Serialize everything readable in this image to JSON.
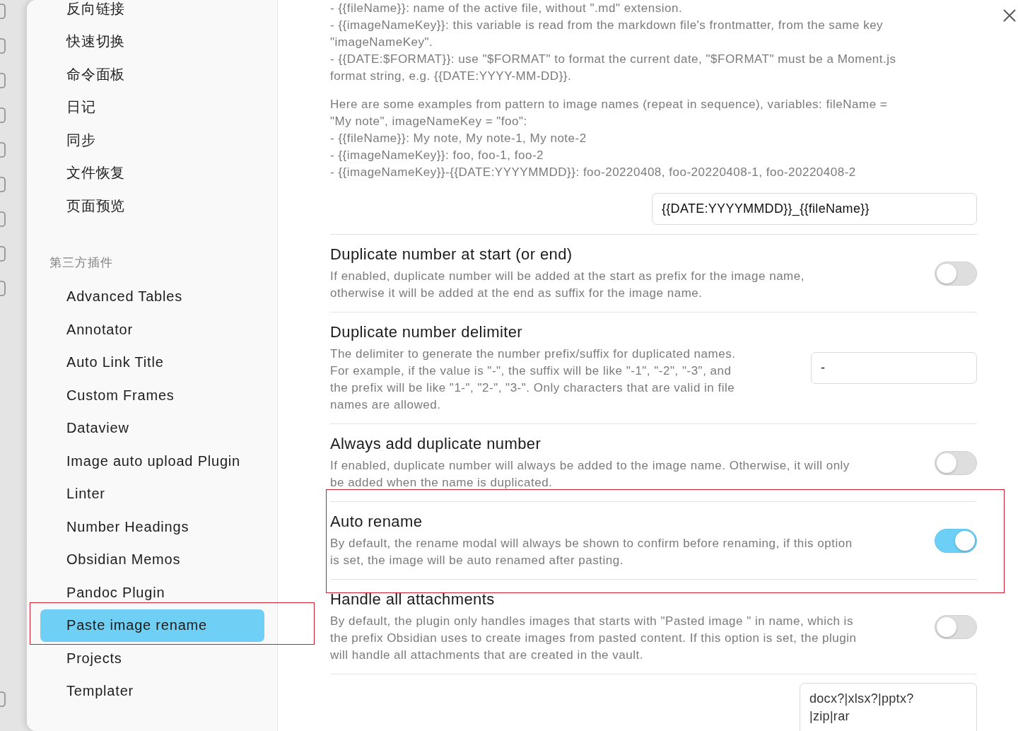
{
  "sidebar": {
    "groups": [
      {
        "items": [
          {
            "label": "反向链接",
            "selected": false,
            "annotated": false
          },
          {
            "label": "快速切换",
            "selected": false,
            "annotated": false
          },
          {
            "label": "命令面板",
            "selected": false,
            "annotated": false
          },
          {
            "label": "日记",
            "selected": false,
            "annotated": false
          },
          {
            "label": "同步",
            "selected": false,
            "annotated": false
          },
          {
            "label": "文件恢复",
            "selected": false,
            "annotated": false
          },
          {
            "label": "页面预览",
            "selected": false,
            "annotated": false
          }
        ]
      },
      {
        "heading": "第三方插件",
        "items": [
          {
            "label": "Advanced Tables",
            "selected": false,
            "annotated": false
          },
          {
            "label": "Annotator",
            "selected": false,
            "annotated": false
          },
          {
            "label": "Auto Link Title",
            "selected": false,
            "annotated": false
          },
          {
            "label": "Custom Frames",
            "selected": false,
            "annotated": false
          },
          {
            "label": "Dataview",
            "selected": false,
            "annotated": false
          },
          {
            "label": "Image auto upload Plugin",
            "selected": false,
            "annotated": false
          },
          {
            "label": "Linter",
            "selected": false,
            "annotated": false
          },
          {
            "label": "Number Headings",
            "selected": false,
            "annotated": false
          },
          {
            "label": "Obsidian Memos",
            "selected": false,
            "annotated": false
          },
          {
            "label": "Pandoc Plugin",
            "selected": false,
            "annotated": false
          },
          {
            "label": "Paste image rename",
            "selected": true,
            "annotated": true
          },
          {
            "label": "Projects",
            "selected": false,
            "annotated": false
          },
          {
            "label": "Templater",
            "selected": false,
            "annotated": false
          }
        ]
      }
    ]
  },
  "content": {
    "description": [
      [
        "- {{fileName}}: name of the active file, without \".md\" extension.",
        "- {{imageNameKey}}: this variable is read from the markdown file's frontmatter, from the same key",
        "\"imageNameKey\".",
        "- {{DATE:$FORMAT}}: use \"$FORMAT\" to format the current date, \"$FORMAT\" must be a Moment.js",
        "format string, e.g. {{DATE:YYYY-MM-DD}}."
      ],
      [
        "Here are some examples from pattern to image names (repeat in sequence), variables: fileName =",
        "\"My note\", imageNameKey = \"foo\":",
        "- {{fileName}}: My note, My note-1, My note-2",
        "- {{imageNameKey}}: foo, foo-1, foo-2",
        "- {{imageNameKey}}-{{DATE:YYYYMMDD}}: foo-20220408, foo-20220408-1, foo-20220408-2"
      ]
    ],
    "pattern_field": {
      "value": "{{DATE:YYYYMMDD}}_{{fileName}}"
    },
    "settings": [
      {
        "kind": "toggle",
        "title": "Duplicate number at start (or end)",
        "description": [
          "If enabled, duplicate number will be added at the start as prefix for the image name,",
          "otherwise it will be added at the end as suffix for the image name."
        ],
        "on": false,
        "annotated": false
      },
      {
        "kind": "text",
        "title": "Duplicate number delimiter",
        "description": [
          "The delimiter to generate the number prefix/suffix for duplicated names.",
          "For example, if the value is \"-\", the suffix will be like \"-1\", \"-2\", \"-3\", and",
          "the prefix will be like \"1-\", \"2-\", \"3-\". Only characters that are valid in file",
          "names are allowed."
        ],
        "value": "-",
        "annotated": false
      },
      {
        "kind": "toggle",
        "title": "Always add duplicate number",
        "description": [
          "If enabled, duplicate number will always be added to the image name. Otherwise, it will only",
          "be added when the name is duplicated."
        ],
        "on": false,
        "annotated": false
      },
      {
        "kind": "toggle",
        "title": "Auto rename",
        "description": [
          "By default, the rename modal will always be shown to confirm before renaming, if this option",
          "is set, the image will be auto renamed after pasting."
        ],
        "on": true,
        "annotated": true
      },
      {
        "kind": "toggle",
        "title": "Handle all attachments",
        "description": [
          "By default, the plugin only handles images that starts with \"Pasted image \" in name, which is",
          "the prefix Obsidian uses to create images from pasted content. If this option is set, the plugin",
          "will handle all attachments that are created in the vault."
        ],
        "on": false,
        "annotated": false
      }
    ],
    "attachment_field": {
      "lines": [
        "docx?|xlsx?|pptx?",
        "|zip|rar"
      ]
    }
  }
}
